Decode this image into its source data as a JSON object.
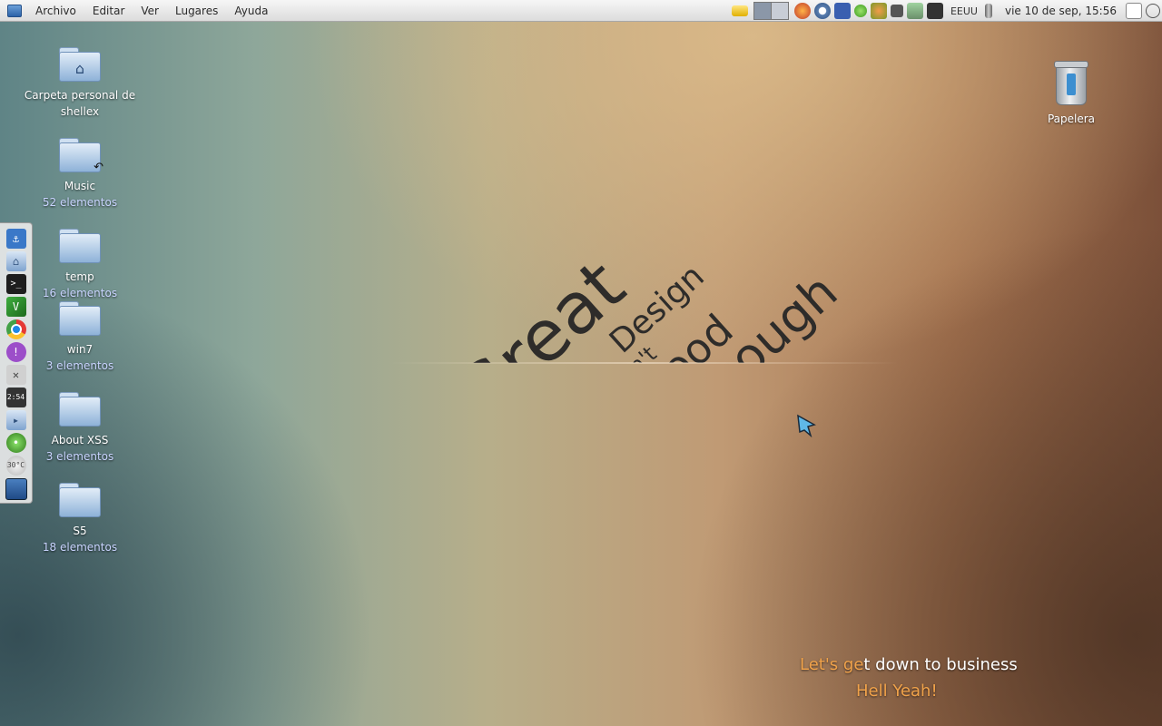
{
  "menubar": {
    "items": [
      "Archivo",
      "Editar",
      "Ver",
      "Lugares",
      "Ayuda"
    ]
  },
  "tray": {
    "keyboard_layout": "EEUU",
    "clock": "vie 10 de sep, 15:56"
  },
  "dock": {
    "temperature_label": "30°C",
    "clock_widget": "2:54"
  },
  "desktop_icons": [
    {
      "name": "Carpeta personal de shellex",
      "sub": ""
    },
    {
      "name": "Music",
      "sub": "52 elementos"
    },
    {
      "name": "temp",
      "sub": "16 elementos"
    },
    {
      "name": "win7",
      "sub": "3 elementos"
    },
    {
      "name": "About XSS",
      "sub": "3 elementos"
    },
    {
      "name": "S5",
      "sub": "18 elementos"
    }
  ],
  "trash": {
    "name": "Papelera"
  },
  "wallpaper": {
    "word1": "Great",
    "word2": "Design",
    "word3": "isn't",
    "word4": "Good",
    "word5": "Enough"
  },
  "caption": {
    "line1_a": "Let's ge",
    "line1_b": "t down to business",
    "line2": "Hell Yeah!"
  }
}
